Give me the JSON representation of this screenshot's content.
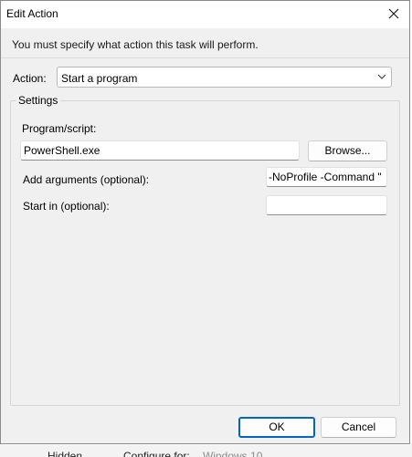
{
  "dialog": {
    "title": "Edit Action",
    "instruction": "You must specify what action this task will perform."
  },
  "action": {
    "label": "Action:",
    "selected": "Start a program"
  },
  "settings": {
    "legend": "Settings",
    "program_label": "Program/script:",
    "program_value": "PowerShell.exe",
    "browse_label": "Browse...",
    "args_label": "Add arguments (optional):",
    "args_value": "-NoProfile -Command \"",
    "startin_label": "Start in (optional):",
    "startin_value": ""
  },
  "buttons": {
    "ok": "OK",
    "cancel": "Cancel"
  },
  "background": {
    "col1": "Hidden",
    "col2": "Configure for:",
    "col3": "Windows 10"
  },
  "icons": {
    "close": "close-icon",
    "dropdown": "chevron-down-icon"
  },
  "colors": {
    "accent": "#0067c0",
    "dialog_bg": "#f0f0f0"
  }
}
